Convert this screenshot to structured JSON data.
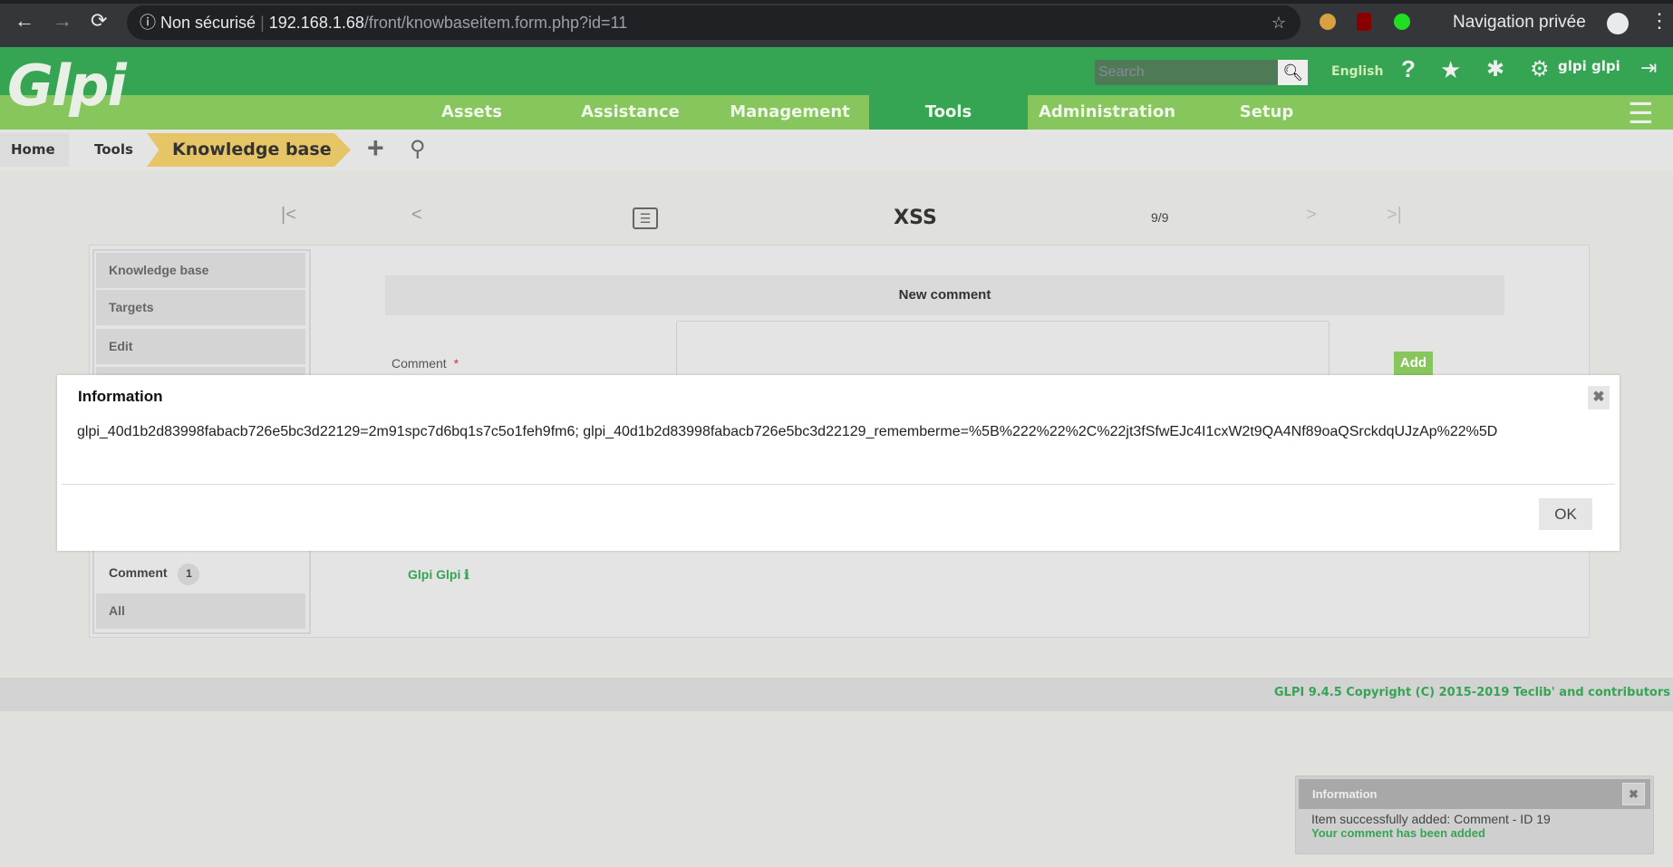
{
  "browser": {
    "security": "Non sécurisé",
    "url_host": "192.168.1.68",
    "url_path": "/front/knowbaseitem.form.php?id=11",
    "profile": "Navigation privée"
  },
  "header": {
    "logo": "Glpi",
    "search_placeholder": "Search",
    "language": "English",
    "user": "glpi glpi"
  },
  "nav": [
    "Assets",
    "Assistance",
    "Management",
    "Tools",
    "Administration",
    "Setup"
  ],
  "breadcrumb": [
    "Home",
    "Tools",
    "Knowledge base"
  ],
  "record": {
    "title": "XSS",
    "position": "9/9"
  },
  "sidebar": {
    "items": [
      "Knowledge base",
      "Targets",
      "Edit"
    ],
    "comment_label": "Comment",
    "comment_count": "1",
    "all": "All"
  },
  "form": {
    "header": "New comment",
    "label": "Comment",
    "required": "*",
    "add": "Add",
    "author": "Glpi Glpi"
  },
  "dialog": {
    "title": "Information",
    "message": "glpi_40d1b2d83998fabacb726e5bc3d22129=2m91spc7d6bq1s7c5o1feh9fm6; glpi_40d1b2d83998fabacb726e5bc3d22129_rememberme=%5B%222%22%2C%22jt3fSfwEJc4I1cxW2t9QA4Nf89oaQSrckdqUJzAp%22%5D",
    "ok": "OK"
  },
  "footer": "GLPI 9.4.5 Copyright (C) 2015-2019 Teclib' and contributors",
  "notification": {
    "title": "Information",
    "line1": "Item successfully added: Comment - ID 19",
    "line2": "Your comment has been added"
  }
}
